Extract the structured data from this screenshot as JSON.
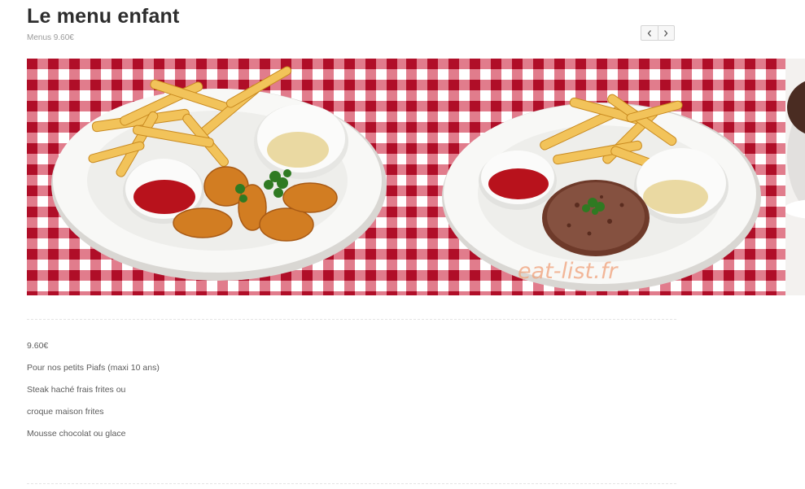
{
  "header": {
    "title": "Le menu enfant",
    "subtitle": "Menus 9.60€"
  },
  "gallery": {
    "nav": {
      "prev_icon": "chevron-left-icon",
      "next_icon": "chevron-right-icon"
    },
    "watermark": "eat-list.fr"
  },
  "description": {
    "lines": [
      "9.60€",
      "Pour nos petits Piafs (maxi 10 ans)",
      "Steak haché frais frites ou",
      "croque maison frites",
      "Mousse chocolat ou glace"
    ]
  },
  "colors": {
    "tablecloth_red": "#c8102e",
    "title_text": "#2d2d2d",
    "body_text": "#5c5c5c"
  }
}
